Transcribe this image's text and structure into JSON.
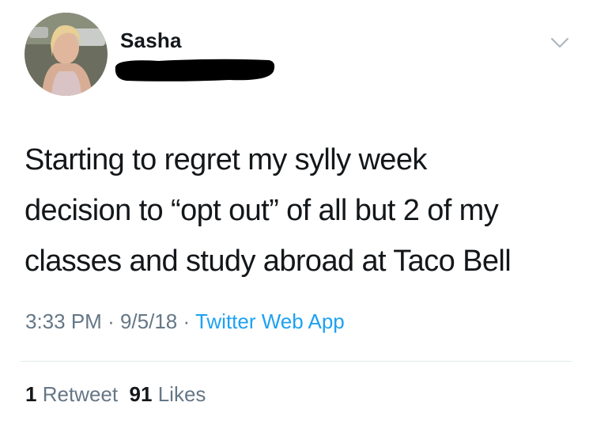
{
  "user": {
    "display_name": "Sasha",
    "avatar_icon": "profile-photo",
    "handle_redacted": true
  },
  "tweet": {
    "text": "Starting to regret my sylly week\ndecision to “opt out” of all but 2 of my\nclasses and study abroad at Taco Bell"
  },
  "meta": {
    "time": "3:33 PM",
    "separator": "·",
    "date": "9/5/18",
    "source": "Twitter Web App"
  },
  "stats": {
    "retweets_count": "1",
    "retweets_label": "Retweet",
    "likes_count": "91",
    "likes_label": "Likes"
  },
  "colors": {
    "text": "#14171a",
    "secondary": "#657786",
    "link": "#1da1f2",
    "divider": "#e1e8ed"
  }
}
